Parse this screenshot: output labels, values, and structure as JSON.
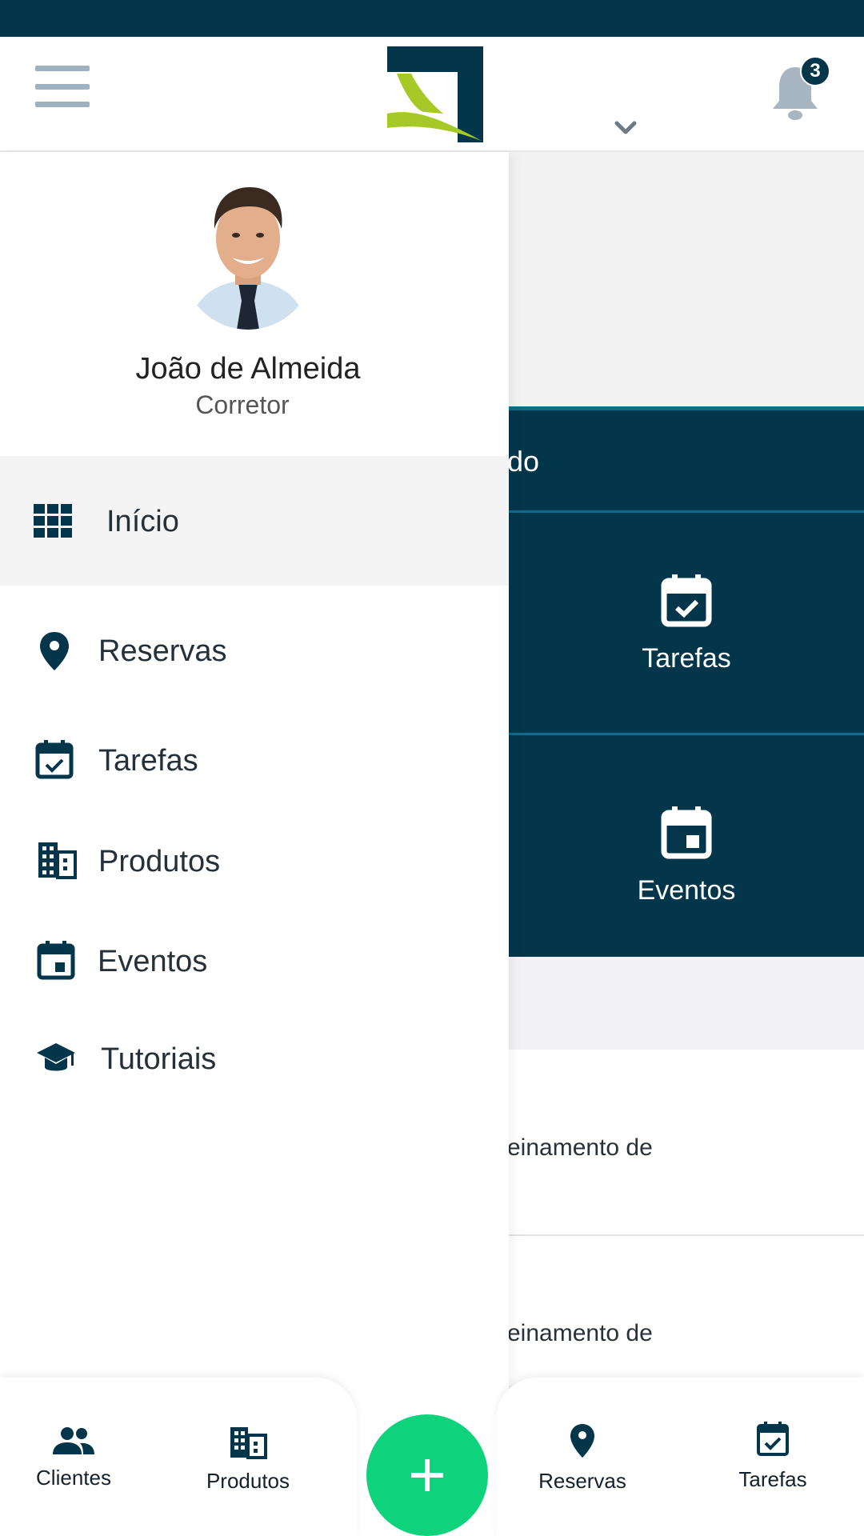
{
  "header": {
    "menu_icon": "hamburger-icon",
    "logo": "brand-logo",
    "dropdown_icon": "chevron-down-icon",
    "notifications_icon": "bell-icon",
    "notifications_count": "3"
  },
  "user": {
    "name": "João de Almeida",
    "role": "Corretor"
  },
  "drawer": {
    "items": [
      {
        "label": "Início",
        "icon": "grid-icon",
        "active": true
      },
      {
        "label": "Reservas",
        "icon": "location-pin-icon"
      },
      {
        "label": "Tarefas",
        "icon": "calendar-check-icon"
      },
      {
        "label": "Produtos",
        "icon": "building-icon"
      },
      {
        "label": "Eventos",
        "icon": "calendar-event-icon"
      },
      {
        "label": "Tutoriais",
        "icon": "graduation-cap-icon"
      }
    ]
  },
  "background": {
    "partial_text": "do",
    "tiles": [
      {
        "label": "Tarefas",
        "icon": "calendar-check-icon"
      },
      {
        "label": "Eventos",
        "icon": "calendar-event-icon"
      }
    ],
    "cards": [
      {
        "text": "einamento de"
      },
      {
        "text": "einamento de"
      }
    ]
  },
  "bottom_nav": {
    "tabs": [
      {
        "label": "Clientes",
        "icon": "people-icon"
      },
      {
        "label": "Produtos",
        "icon": "building-icon"
      },
      {
        "label": "Reservas",
        "icon": "location-pin-icon"
      },
      {
        "label": "Tarefas",
        "icon": "calendar-check-icon"
      }
    ],
    "fab_icon": "plus-icon"
  },
  "colors": {
    "primary": "#04364b",
    "accent_green": "#0fd27d",
    "logo_green": "#a6c927"
  }
}
